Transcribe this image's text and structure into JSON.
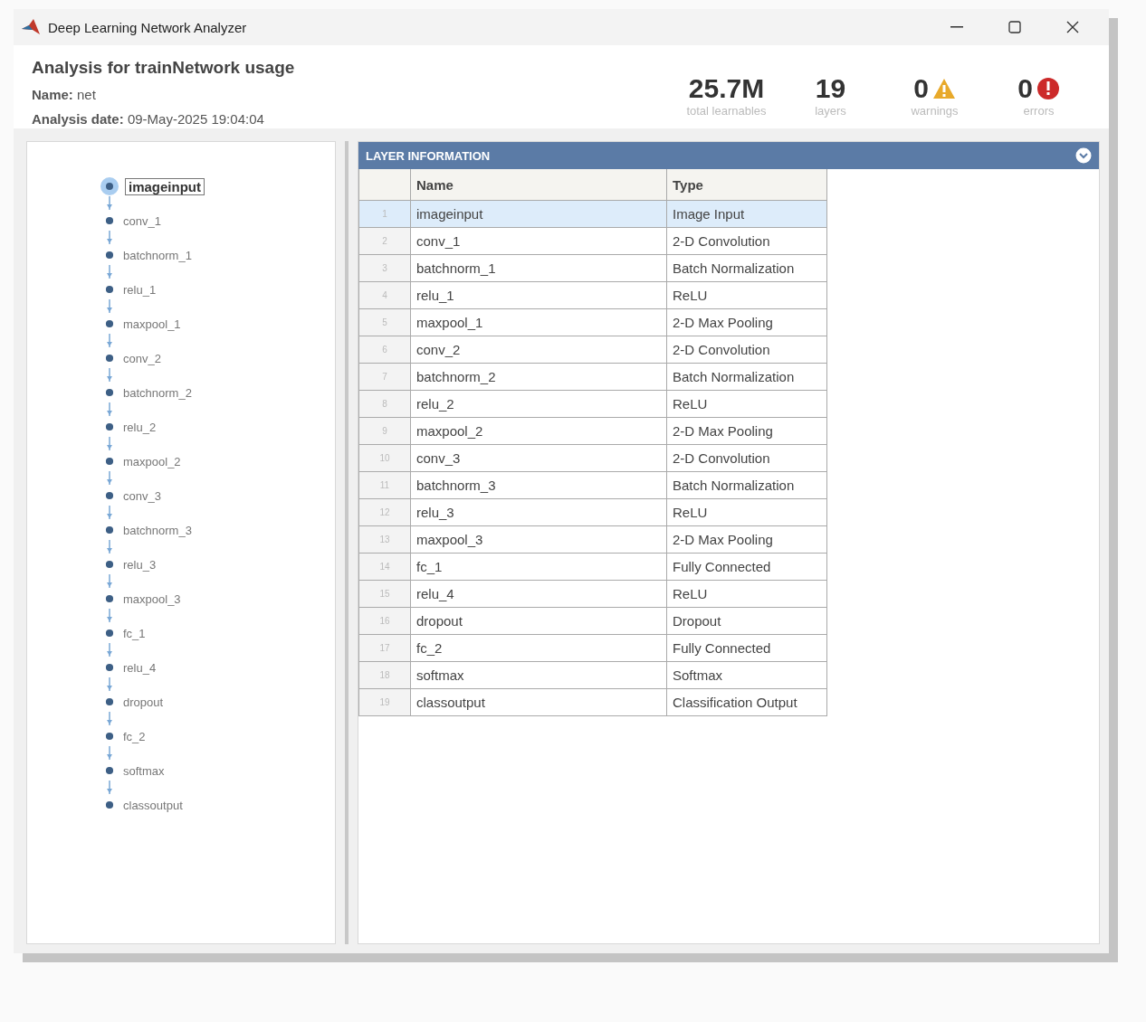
{
  "window": {
    "title": "Deep Learning Network Analyzer"
  },
  "summary": {
    "title": "Analysis for trainNetwork usage",
    "fields": [
      {
        "label": "Name:",
        "value": "net"
      },
      {
        "label": "Analysis date:",
        "value": "09-May-2025 19:04:04"
      }
    ]
  },
  "stats": [
    {
      "kind": "plain",
      "value": "25.7M",
      "label": "total learnables"
    },
    {
      "kind": "plain",
      "value": "19",
      "label": "layers"
    },
    {
      "kind": "warning",
      "value": "0",
      "label": "warnings"
    },
    {
      "kind": "error",
      "value": "0",
      "label": "errors"
    }
  ],
  "graph": {
    "nodes": [
      {
        "label": "imageinput",
        "selected": true
      },
      {
        "label": "conv_1",
        "selected": false
      },
      {
        "label": "batchnorm_1",
        "selected": false
      },
      {
        "label": "relu_1",
        "selected": false
      },
      {
        "label": "maxpool_1",
        "selected": false
      },
      {
        "label": "conv_2",
        "selected": false
      },
      {
        "label": "batchnorm_2",
        "selected": false
      },
      {
        "label": "relu_2",
        "selected": false
      },
      {
        "label": "maxpool_2",
        "selected": false
      },
      {
        "label": "conv_3",
        "selected": false
      },
      {
        "label": "batchnorm_3",
        "selected": false
      },
      {
        "label": "relu_3",
        "selected": false
      },
      {
        "label": "maxpool_3",
        "selected": false
      },
      {
        "label": "fc_1",
        "selected": false
      },
      {
        "label": "relu_4",
        "selected": false
      },
      {
        "label": "dropout",
        "selected": false
      },
      {
        "label": "fc_2",
        "selected": false
      },
      {
        "label": "softmax",
        "selected": false
      },
      {
        "label": "classoutput",
        "selected": false
      }
    ]
  },
  "layer_table": {
    "title": "LAYER INFORMATION",
    "columns": [
      "Name",
      "Type"
    ],
    "rows": [
      {
        "index": "1",
        "name": "imageinput",
        "type": "Image Input",
        "selected": true
      },
      {
        "index": "2",
        "name": "conv_1",
        "type": "2-D Convolution",
        "selected": false
      },
      {
        "index": "3",
        "name": "batchnorm_1",
        "type": "Batch Normalization",
        "selected": false
      },
      {
        "index": "4",
        "name": "relu_1",
        "type": "ReLU",
        "selected": false
      },
      {
        "index": "5",
        "name": "maxpool_1",
        "type": "2-D Max Pooling",
        "selected": false
      },
      {
        "index": "6",
        "name": "conv_2",
        "type": "2-D Convolution",
        "selected": false
      },
      {
        "index": "7",
        "name": "batchnorm_2",
        "type": "Batch Normalization",
        "selected": false
      },
      {
        "index": "8",
        "name": "relu_2",
        "type": "ReLU",
        "selected": false
      },
      {
        "index": "9",
        "name": "maxpool_2",
        "type": "2-D Max Pooling",
        "selected": false
      },
      {
        "index": "10",
        "name": "conv_3",
        "type": "2-D Convolution",
        "selected": false
      },
      {
        "index": "11",
        "name": "batchnorm_3",
        "type": "Batch Normalization",
        "selected": false
      },
      {
        "index": "12",
        "name": "relu_3",
        "type": "ReLU",
        "selected": false
      },
      {
        "index": "13",
        "name": "maxpool_3",
        "type": "2-D Max Pooling",
        "selected": false
      },
      {
        "index": "14",
        "name": "fc_1",
        "type": "Fully Connected",
        "selected": false
      },
      {
        "index": "15",
        "name": "relu_4",
        "type": "ReLU",
        "selected": false
      },
      {
        "index": "16",
        "name": "dropout",
        "type": "Dropout",
        "selected": false
      },
      {
        "index": "17",
        "name": "fc_2",
        "type": "Fully Connected",
        "selected": false
      },
      {
        "index": "18",
        "name": "softmax",
        "type": "Softmax",
        "selected": false
      },
      {
        "index": "19",
        "name": "classoutput",
        "type": "Classification Output",
        "selected": false
      }
    ]
  }
}
